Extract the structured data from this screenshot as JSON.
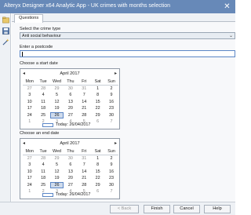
{
  "window": {
    "title": "Alteryx Designer x64 Analytic App - UK crimes with months selection"
  },
  "tabs": [
    {
      "label": "Questions"
    }
  ],
  "crime": {
    "label": "Select the crime type",
    "value": "Anti social behaviour"
  },
  "postcode": {
    "label": "Enter a postcode",
    "value": ""
  },
  "start": {
    "label": "Choose a start date",
    "month": "April 2017",
    "today": "Today: 26/04/2017",
    "days": [
      "Mon",
      "Tue",
      "Wed",
      "Thu",
      "Fri",
      "Sat",
      "Sun"
    ],
    "weeks": [
      [
        "27",
        "28",
        "29",
        "30",
        "31",
        "1",
        "2"
      ],
      [
        "3",
        "4",
        "5",
        "6",
        "7",
        "8",
        "9"
      ],
      [
        "10",
        "11",
        "12",
        "13",
        "14",
        "15",
        "16"
      ],
      [
        "17",
        "18",
        "19",
        "20",
        "21",
        "22",
        "23"
      ],
      [
        "24",
        "25",
        "26",
        "27",
        "28",
        "29",
        "30"
      ],
      [
        "1",
        "2",
        "3",
        "4",
        "5",
        "6",
        "7"
      ]
    ],
    "selected": "26"
  },
  "end": {
    "label": "Choose an end date",
    "month": "April 2017",
    "today": "Today: 26/04/2017",
    "days": [
      "Mon",
      "Tue",
      "Wed",
      "Thu",
      "Fri",
      "Sat",
      "Sun"
    ],
    "weeks": [
      [
        "27",
        "28",
        "29",
        "30",
        "31",
        "1",
        "2"
      ],
      [
        "3",
        "4",
        "5",
        "6",
        "7",
        "8",
        "9"
      ],
      [
        "10",
        "11",
        "12",
        "13",
        "14",
        "15",
        "16"
      ],
      [
        "17",
        "18",
        "19",
        "20",
        "21",
        "22",
        "23"
      ],
      [
        "24",
        "25",
        "26",
        "27",
        "28",
        "29",
        "30"
      ],
      [
        "1",
        "2",
        "3",
        "4",
        "5",
        "6",
        "7"
      ]
    ],
    "selected": "26"
  },
  "footer": {
    "back": "< Back",
    "finish": "Finish",
    "cancel": "Cancel",
    "help": "Help"
  },
  "colors": {
    "titlebar": "#6789b8",
    "accent": "#5b86c6",
    "selected_day": "#cfdbec"
  },
  "icons": {
    "close": "close-icon",
    "prev": "chevron-left-icon",
    "next": "chevron-right-icon"
  }
}
